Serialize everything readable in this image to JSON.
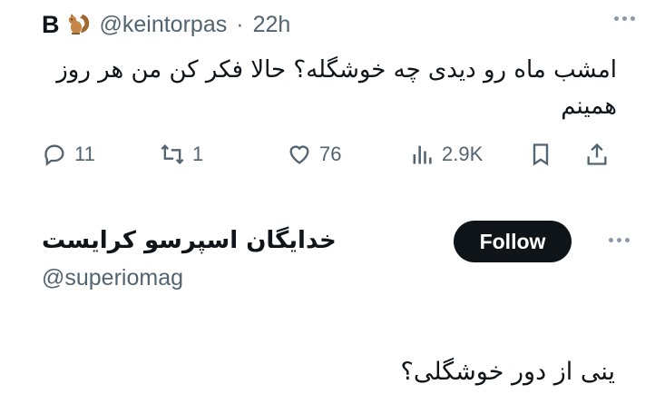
{
  "quoted_tweet": {
    "name": "B",
    "avatar_emoji": "squirrel-icon",
    "handle": "@keintorpas",
    "separator": "·",
    "time": "22h",
    "text": "امشب ماه رو دیدی چه خوشگله؟ حالا فکر کن من هر روز همینم",
    "actions": {
      "replies": "11",
      "reposts": "1",
      "likes": "76",
      "views": "2.9K"
    }
  },
  "author": {
    "name": "خدایگان اسپرسو کرایست",
    "handle": "@superiomag",
    "follow_label": "Follow"
  },
  "reply": {
    "text": "ینی از دور خوشگلی؟"
  },
  "colors": {
    "text": "#0f1419",
    "muted": "#536471",
    "button_bg": "#0f1419",
    "button_text": "#ffffff"
  }
}
